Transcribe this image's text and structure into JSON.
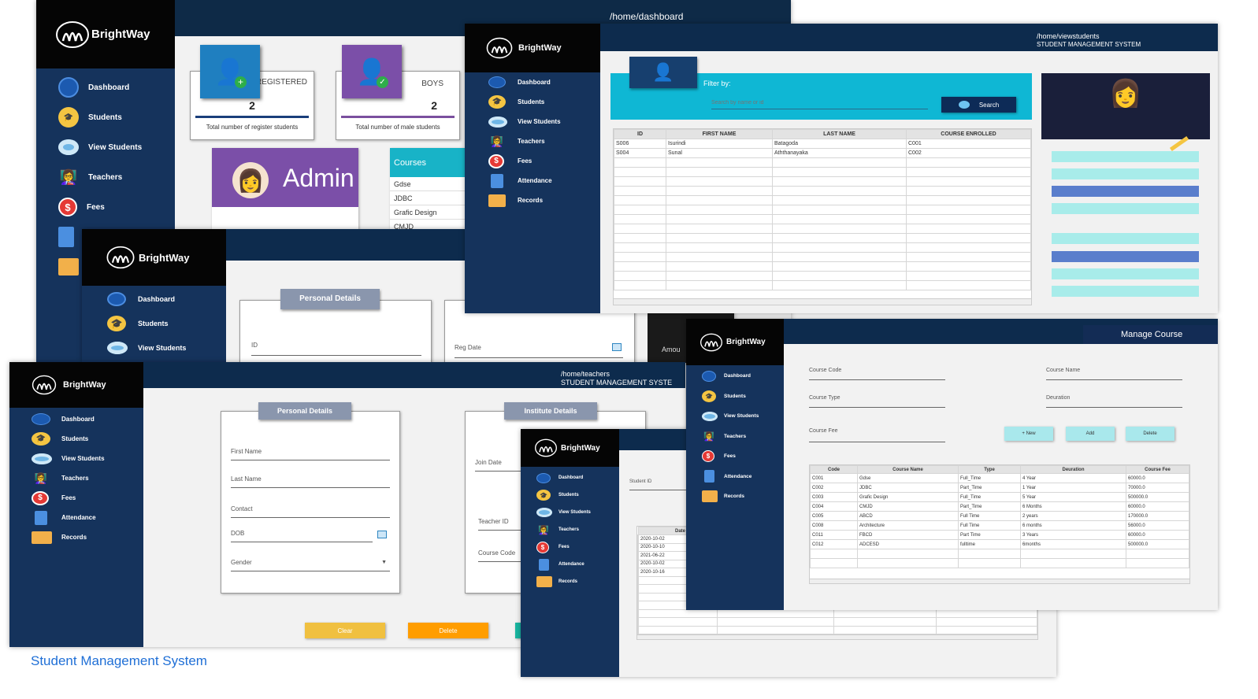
{
  "brand": "BrightWay",
  "caption": "Student Management System",
  "nav": {
    "dashboard": "Dashboard",
    "students": "Students",
    "view_students": "View Students",
    "teachers": "Teachers",
    "fees": "Fees",
    "attendance": "Attendance",
    "records": "Records"
  },
  "dashboard": {
    "path": "/home/dashboard",
    "registered_label": "REGISTERED",
    "registered_value": "2",
    "registered_caption": "Total number of register students",
    "boys_label": "BOYS",
    "boys_value": "2",
    "boys_caption": "Total number of male students",
    "admin_label": "Admin",
    "courses_title": "Courses",
    "courses": [
      "Gdse",
      "JDBC",
      "Grafic Design",
      "CMJD"
    ]
  },
  "view_students": {
    "path": "/home/viewstudents",
    "system_title": "STUDENT MANAGEMENT SYSTEM",
    "filter_label": "Filter by:",
    "search_placeholder": "Search by name or id",
    "search_button": "Search",
    "columns": [
      "ID",
      "FIRST NAME",
      "LAST NAME",
      "COURSE ENROLLED"
    ],
    "rows": [
      [
        "S006",
        "Isurindi",
        "Batagoda",
        "C001"
      ],
      [
        "S004",
        "Sunal",
        "Aththanayaka",
        "C002"
      ]
    ]
  },
  "students_form": {
    "personal_title": "Personal Details",
    "id_label": "ID",
    "reg_date_label": "Reg Date",
    "amount_label": "Amou"
  },
  "teachers": {
    "path": "/home/teachers",
    "system_title": "STUDENT MANAGEMENT SYSTE",
    "personal_title": "Personal Details",
    "institute_title": "Institute Details",
    "first_name": "First Name",
    "last_name": "Last Name",
    "contact": "Contact",
    "dob": "DOB",
    "gender": "Gender",
    "join_date": "Join Date",
    "teacher_id": "Teacher ID",
    "course_code": "Course Code",
    "clear_button": "Clear",
    "delete_button": "Delete"
  },
  "attendance": {
    "student_id_label": "Student ID",
    "date_header": "Date",
    "dates": [
      "2020-10-02",
      "2020-10-10",
      "2021-06-22",
      "2020-10-02",
      "2020-10-16"
    ]
  },
  "manage_course": {
    "title": "Manage Course",
    "course_code": "Course Code",
    "course_name": "Course Name",
    "course_type": "Course Type",
    "duration": "Deuration",
    "course_fee": "Course Fee",
    "new_button": "+ New",
    "add_button": "Add",
    "delete_button": "Delete",
    "columns": [
      "Code",
      "Course Name",
      "Type",
      "Deuration",
      "Course Fee"
    ],
    "rows": [
      [
        "C001",
        "Gdse",
        "Full_Time",
        "4 Year",
        "60000.0"
      ],
      [
        "C002",
        "JDBC",
        "Part_Time",
        "1 Year",
        "70000.0"
      ],
      [
        "C003",
        "Grafic Design",
        "Full_Time",
        "5 Year",
        "500000.0"
      ],
      [
        "C004",
        "CMJD",
        "Part_Time",
        "6 Months",
        "60000.0"
      ],
      [
        "C005",
        "ABCD",
        "Full Time",
        "2 years",
        "170000.0"
      ],
      [
        "C008",
        "Architecture",
        "Full Time",
        "6 months",
        "56000.0"
      ],
      [
        "C011",
        "FBCD",
        "Part Time",
        "3 Years",
        "60000.0"
      ],
      [
        "C012",
        "ADCESD",
        "fulltime",
        "6months",
        "500000.0"
      ]
    ]
  }
}
